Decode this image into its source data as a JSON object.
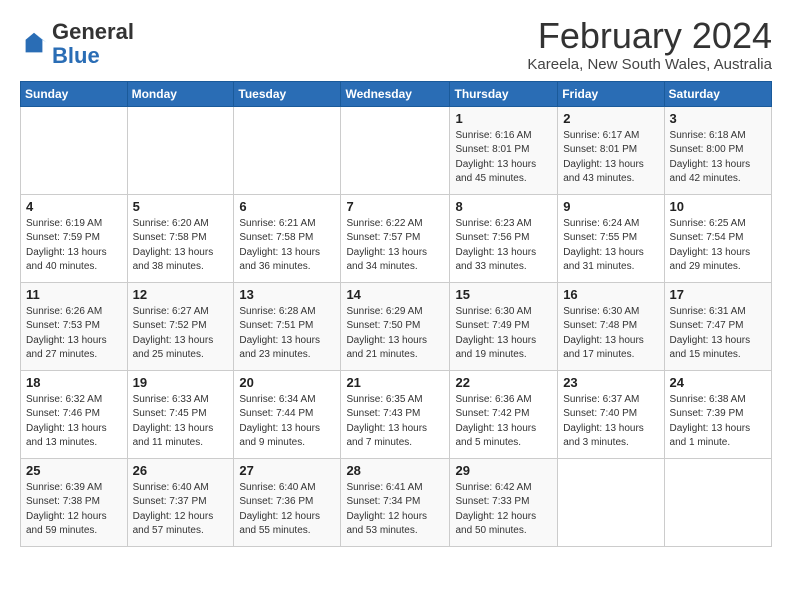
{
  "logo": {
    "general": "General",
    "blue": "Blue"
  },
  "header": {
    "month_year": "February 2024",
    "location": "Kareela, New South Wales, Australia"
  },
  "days_of_week": [
    "Sunday",
    "Monday",
    "Tuesday",
    "Wednesday",
    "Thursday",
    "Friday",
    "Saturday"
  ],
  "weeks": [
    [
      {
        "day": "",
        "info": ""
      },
      {
        "day": "",
        "info": ""
      },
      {
        "day": "",
        "info": ""
      },
      {
        "day": "",
        "info": ""
      },
      {
        "day": "1",
        "info": "Sunrise: 6:16 AM\nSunset: 8:01 PM\nDaylight: 13 hours\nand 45 minutes."
      },
      {
        "day": "2",
        "info": "Sunrise: 6:17 AM\nSunset: 8:01 PM\nDaylight: 13 hours\nand 43 minutes."
      },
      {
        "day": "3",
        "info": "Sunrise: 6:18 AM\nSunset: 8:00 PM\nDaylight: 13 hours\nand 42 minutes."
      }
    ],
    [
      {
        "day": "4",
        "info": "Sunrise: 6:19 AM\nSunset: 7:59 PM\nDaylight: 13 hours\nand 40 minutes."
      },
      {
        "day": "5",
        "info": "Sunrise: 6:20 AM\nSunset: 7:58 PM\nDaylight: 13 hours\nand 38 minutes."
      },
      {
        "day": "6",
        "info": "Sunrise: 6:21 AM\nSunset: 7:58 PM\nDaylight: 13 hours\nand 36 minutes."
      },
      {
        "day": "7",
        "info": "Sunrise: 6:22 AM\nSunset: 7:57 PM\nDaylight: 13 hours\nand 34 minutes."
      },
      {
        "day": "8",
        "info": "Sunrise: 6:23 AM\nSunset: 7:56 PM\nDaylight: 13 hours\nand 33 minutes."
      },
      {
        "day": "9",
        "info": "Sunrise: 6:24 AM\nSunset: 7:55 PM\nDaylight: 13 hours\nand 31 minutes."
      },
      {
        "day": "10",
        "info": "Sunrise: 6:25 AM\nSunset: 7:54 PM\nDaylight: 13 hours\nand 29 minutes."
      }
    ],
    [
      {
        "day": "11",
        "info": "Sunrise: 6:26 AM\nSunset: 7:53 PM\nDaylight: 13 hours\nand 27 minutes."
      },
      {
        "day": "12",
        "info": "Sunrise: 6:27 AM\nSunset: 7:52 PM\nDaylight: 13 hours\nand 25 minutes."
      },
      {
        "day": "13",
        "info": "Sunrise: 6:28 AM\nSunset: 7:51 PM\nDaylight: 13 hours\nand 23 minutes."
      },
      {
        "day": "14",
        "info": "Sunrise: 6:29 AM\nSunset: 7:50 PM\nDaylight: 13 hours\nand 21 minutes."
      },
      {
        "day": "15",
        "info": "Sunrise: 6:30 AM\nSunset: 7:49 PM\nDaylight: 13 hours\nand 19 minutes."
      },
      {
        "day": "16",
        "info": "Sunrise: 6:30 AM\nSunset: 7:48 PM\nDaylight: 13 hours\nand 17 minutes."
      },
      {
        "day": "17",
        "info": "Sunrise: 6:31 AM\nSunset: 7:47 PM\nDaylight: 13 hours\nand 15 minutes."
      }
    ],
    [
      {
        "day": "18",
        "info": "Sunrise: 6:32 AM\nSunset: 7:46 PM\nDaylight: 13 hours\nand 13 minutes."
      },
      {
        "day": "19",
        "info": "Sunrise: 6:33 AM\nSunset: 7:45 PM\nDaylight: 13 hours\nand 11 minutes."
      },
      {
        "day": "20",
        "info": "Sunrise: 6:34 AM\nSunset: 7:44 PM\nDaylight: 13 hours\nand 9 minutes."
      },
      {
        "day": "21",
        "info": "Sunrise: 6:35 AM\nSunset: 7:43 PM\nDaylight: 13 hours\nand 7 minutes."
      },
      {
        "day": "22",
        "info": "Sunrise: 6:36 AM\nSunset: 7:42 PM\nDaylight: 13 hours\nand 5 minutes."
      },
      {
        "day": "23",
        "info": "Sunrise: 6:37 AM\nSunset: 7:40 PM\nDaylight: 13 hours\nand 3 minutes."
      },
      {
        "day": "24",
        "info": "Sunrise: 6:38 AM\nSunset: 7:39 PM\nDaylight: 13 hours\nand 1 minute."
      }
    ],
    [
      {
        "day": "25",
        "info": "Sunrise: 6:39 AM\nSunset: 7:38 PM\nDaylight: 12 hours\nand 59 minutes."
      },
      {
        "day": "26",
        "info": "Sunrise: 6:40 AM\nSunset: 7:37 PM\nDaylight: 12 hours\nand 57 minutes."
      },
      {
        "day": "27",
        "info": "Sunrise: 6:40 AM\nSunset: 7:36 PM\nDaylight: 12 hours\nand 55 minutes."
      },
      {
        "day": "28",
        "info": "Sunrise: 6:41 AM\nSunset: 7:34 PM\nDaylight: 12 hours\nand 53 minutes."
      },
      {
        "day": "29",
        "info": "Sunrise: 6:42 AM\nSunset: 7:33 PM\nDaylight: 12 hours\nand 50 minutes."
      },
      {
        "day": "",
        "info": ""
      },
      {
        "day": "",
        "info": ""
      }
    ]
  ]
}
